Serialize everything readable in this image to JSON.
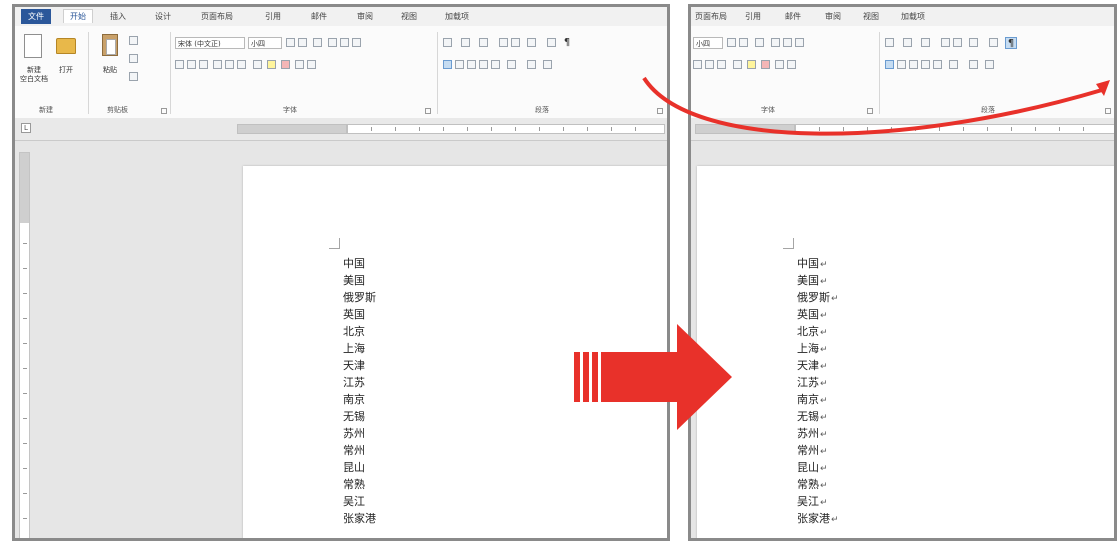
{
  "left_window": {
    "tabs": [
      "文件",
      "开始",
      "插入",
      "设计",
      "页面布局",
      "引用",
      "邮件",
      "审阅",
      "视图",
      "加载项"
    ],
    "active_tab": "开始",
    "new_doc_label": "新建\n空白文档",
    "open_label": "打开",
    "paste_label": "粘贴",
    "group_labels": [
      "新建",
      "剪贴板",
      "字体",
      "段落"
    ],
    "font_name": "宋体 (中文正)",
    "font_size": "小四",
    "pilcrow": "¶"
  },
  "right_window": {
    "tabs": [
      "页面布局",
      "引用",
      "邮件",
      "审阅",
      "视图",
      "加载项"
    ],
    "font_size": "小四",
    "group_labels": [
      "字体",
      "段落"
    ],
    "pilcrow": "¶"
  },
  "document_lines": [
    "中国",
    "美国",
    "俄罗斯",
    "英国",
    "北京",
    "上海",
    "天津",
    "江苏",
    "南京",
    "无锡",
    "苏州",
    "常州",
    "昆山",
    "常熟",
    "吴江",
    "张家港"
  ],
  "paragraph_mark": "↵",
  "colors": {
    "arrow": "#e8312a",
    "tab_file": "#2b579a",
    "highlight": "#c5dcf2"
  }
}
